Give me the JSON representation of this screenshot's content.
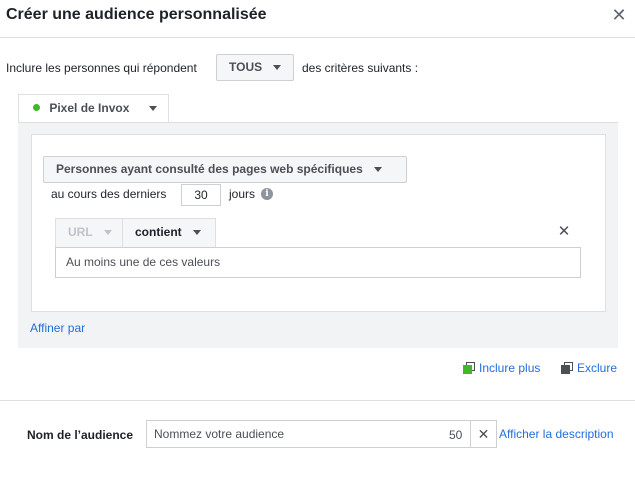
{
  "dialog": {
    "title": "Créer une audience personnalisée",
    "close_glyph": "✕"
  },
  "include": {
    "prefix": "Inclure les personnes qui répondent",
    "selector_value": "TOUS",
    "suffix": "des critères suivants :"
  },
  "source": {
    "label": "Pixel de Invox",
    "status_color": "#42b72a"
  },
  "rule": {
    "event_value": "Personnes ayant consulté des pages web spécifiques",
    "days_prefix": "au cours des derniers",
    "days_value": "30",
    "days_suffix": "jours",
    "info_glyph": "i",
    "field_value": "URL",
    "operator_value": "contient",
    "remove_glyph": "✕",
    "values_placeholder": "Au moins une de ces valeurs"
  },
  "refine": {
    "label": "Affiner par"
  },
  "actions": {
    "include_more": "Inclure plus",
    "exclude": "Exclure"
  },
  "audience_name": {
    "label": "Nom de l’audience",
    "placeholder": "Nommez votre audience",
    "char_count": "50",
    "clear_glyph": "✕",
    "description_link": "Afficher la description"
  },
  "colors": {
    "link": "#216fdb",
    "panel_bg": "#f2f3f5",
    "border": "#dddfe2"
  }
}
